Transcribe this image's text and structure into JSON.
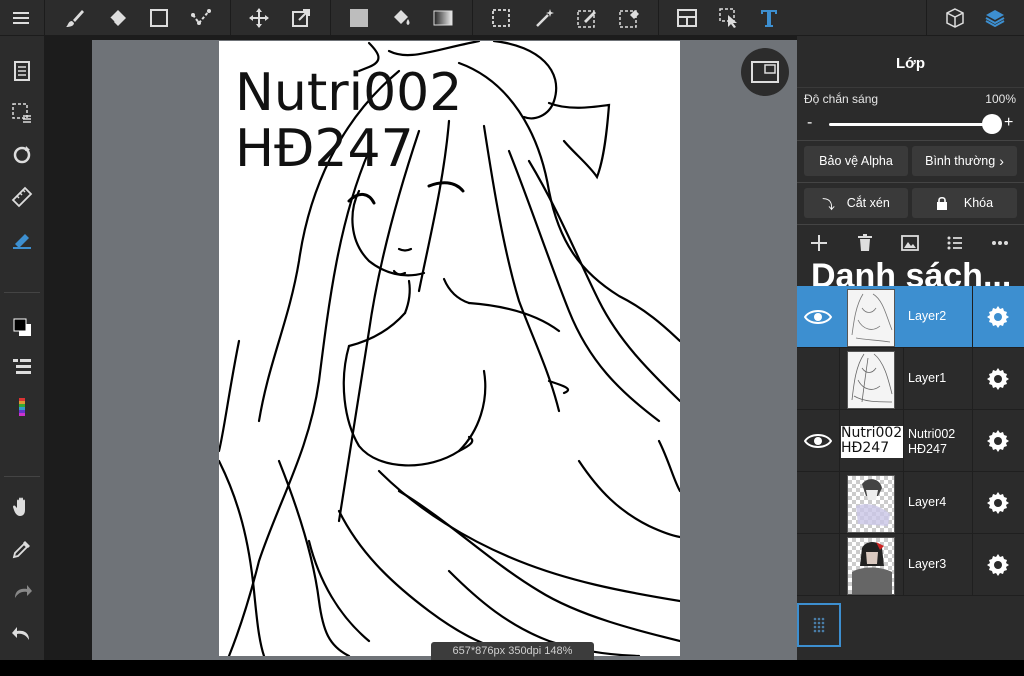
{
  "toolbar": {
    "items": [
      "menu-icon",
      "brush-icon",
      "eraser-icon",
      "rectangle-icon",
      "selection-shape-icon",
      "move-icon",
      "transform-icon",
      "fill-color-icon",
      "bucket-icon",
      "gradient-icon",
      "select-rect-icon",
      "magic-wand-icon",
      "select-pen-icon",
      "select-eraser-icon",
      "frame-icon",
      "operation-icon",
      "text-icon",
      "3d-icon",
      "layers-icon"
    ]
  },
  "leftbar": {
    "items": [
      "layer-menu-icon",
      "select-layer-icon",
      "rotate-icon",
      "ruler-icon",
      "snap-pen-icon",
      "color-icon",
      "layer-list-icon",
      "color-bar-icon",
      "hand-icon",
      "eyedropper-icon",
      "redo-icon",
      "undo-icon"
    ]
  },
  "canvas": {
    "text": "Nutri002\nHĐ247",
    "status": "657*876px 350dpi 148%"
  },
  "panel": {
    "title": "Lớp",
    "opacity_label": "Độ chắn sáng",
    "opacity_value": "100%",
    "opacity_fraction": 1.0,
    "minus": "-",
    "plus": "+",
    "alpha_protect": "Bảo vệ Alpha",
    "blend_mode": "Bình thường",
    "clip": "Cắt xén",
    "lock": "Khóa",
    "list_title": "Danh sách...",
    "accent": "#3d8fd0"
  },
  "layers": [
    {
      "name": "Layer2",
      "visible": true,
      "selected": true
    },
    {
      "name": "Layer1",
      "visible": false,
      "selected": false
    },
    {
      "name": "Nutri002\nHĐ247",
      "visible": true,
      "selected": false,
      "thumb_text": "Nutri002\nHĐ247"
    },
    {
      "name": "Layer4",
      "visible": false,
      "selected": false
    },
    {
      "name": "Layer3",
      "visible": false,
      "selected": false
    }
  ]
}
